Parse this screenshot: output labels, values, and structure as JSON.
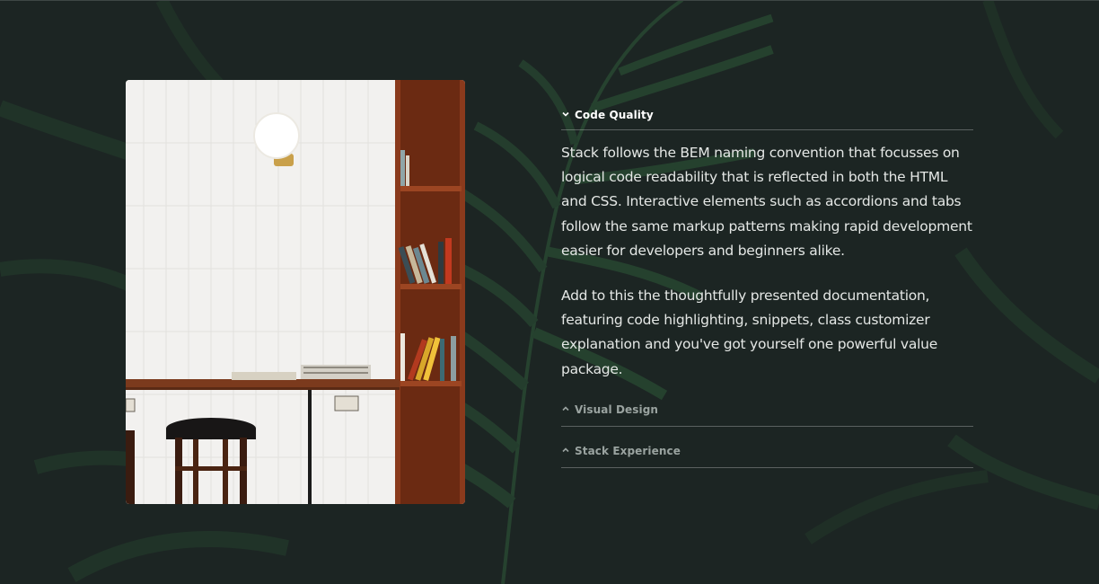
{
  "section": {
    "image": {
      "description_icon": "cafe-photo"
    },
    "accordion": {
      "items": [
        {
          "title": "Code Quality",
          "state": "expanded",
          "paragraphs": [
            "Stack follows the BEM naming convention that focusses on logical code readability that is reflected in both the HTML and CSS. Interactive elements such as accordions and tabs follow the same markup patterns making rapid development easier for developers and beginners alike.",
            "Add to this the thoughtfully presented documentation, featuring code highlighting, snippets, class customizer explanation and you've got yourself one powerful value package."
          ]
        },
        {
          "title": "Visual Design",
          "state": "collapsed"
        },
        {
          "title": "Stack Experience",
          "state": "collapsed"
        }
      ]
    }
  },
  "colors": {
    "background": "#1c2523",
    "leaf": "#2f5a3a",
    "text": "#e4e7e5",
    "muted_label": "#9aa3a0"
  }
}
